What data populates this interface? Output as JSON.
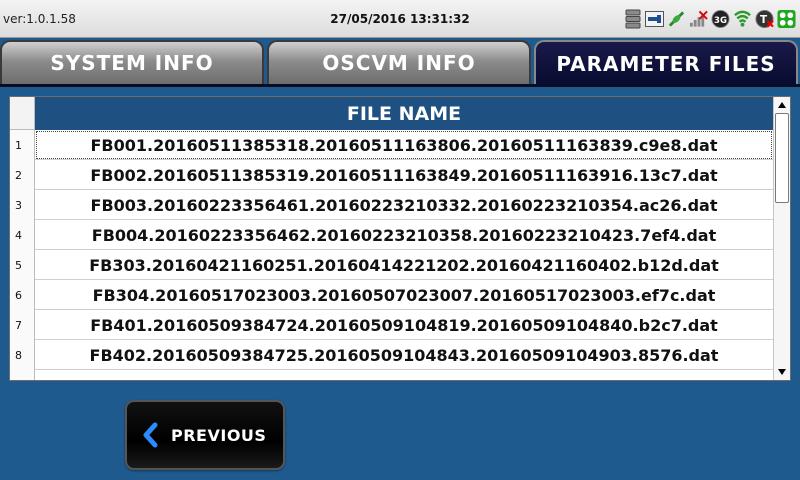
{
  "status_bar": {
    "version": "ver:1.0.1.58",
    "datetime": "27/05/2016 13:31:32",
    "icons": [
      "storage-icon",
      "usb-icon",
      "connection-icon",
      "signal-icon",
      "3g-icon",
      "wifi-icon",
      "tx-icon",
      "network-icon"
    ],
    "icon_3g_label": "3G",
    "icon_t_label": "T"
  },
  "tabs": [
    {
      "label": "SYSTEM INFO",
      "active": false
    },
    {
      "label": "OSCVM INFO",
      "active": false
    },
    {
      "label": "PARAMETER FILES",
      "active": true
    }
  ],
  "table": {
    "column_header": "FILE NAME",
    "rows": [
      {
        "num": "1",
        "file": "FB001.20160511385318.20160511163806.20160511163839.c9e8.dat"
      },
      {
        "num": "2",
        "file": "FB002.20160511385319.20160511163849.20160511163916.13c7.dat"
      },
      {
        "num": "3",
        "file": "FB003.20160223356461.20160223210332.20160223210354.ac26.dat"
      },
      {
        "num": "4",
        "file": "FB004.20160223356462.20160223210358.20160223210423.7ef4.dat"
      },
      {
        "num": "5",
        "file": "FB303.20160421160251.20160414221202.20160421160402.b12d.dat"
      },
      {
        "num": "6",
        "file": "FB304.20160517023003.20160507023007.20160517023003.ef7c.dat"
      },
      {
        "num": "7",
        "file": "FB401.20160509384724.20160509104819.20160509104840.b2c7.dat"
      },
      {
        "num": "8",
        "file": "FB402.20160509384725.20160509104843.20160509104903.8576.dat"
      }
    ]
  },
  "previous_button": {
    "label": "PREVIOUS"
  },
  "colors": {
    "background": "#1f5a8e",
    "header": "#1e5081",
    "active_tab": "#070b2e"
  }
}
